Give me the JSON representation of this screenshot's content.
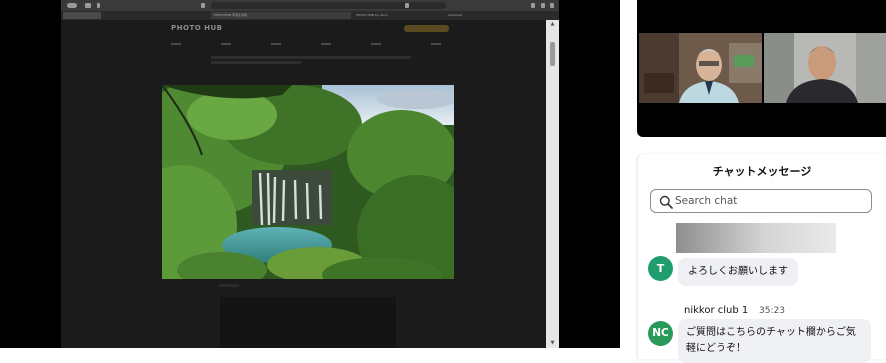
{
  "shared_screen": {
    "tabs": [
      {
        "label": "PHOTOHUB 写真を共有"
      },
      {
        "label": "PHOTO HUB by nikon"
      },
      {
        "label": "photohub"
      }
    ],
    "site_logo": "PHOTO HUB",
    "photo_description_icon": "waterfall-photo"
  },
  "video": {
    "participants": [
      "participant-a",
      "participant-b"
    ]
  },
  "chat": {
    "title": "チャットメッセージ",
    "search_placeholder": "Search chat",
    "messages": [
      {
        "avatar": "T",
        "avatar_color": "#1f9d6c",
        "text": "よろしくお願いします"
      },
      {
        "avatar": "NC",
        "avatar_color": "#2a9a5a",
        "sender": "nikkor club 1",
        "time": "35:23",
        "text_line1": "ご質問はこちらのチャット欄からご気",
        "text_line2": "軽にどうぞ！"
      }
    ]
  }
}
